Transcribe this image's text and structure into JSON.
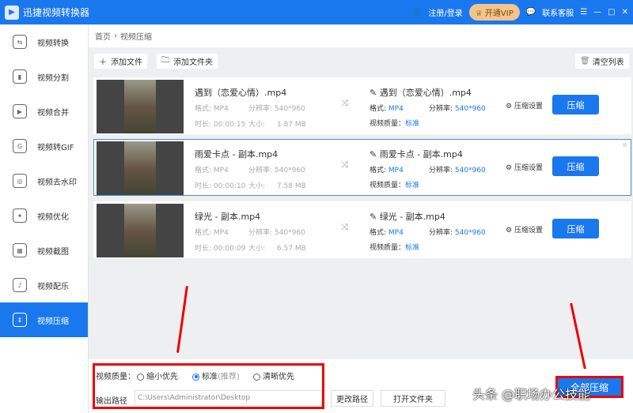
{
  "app": {
    "title": "迅捷视频转换器",
    "login": "注册/登录",
    "vip": "开通VIP",
    "support": "联系客服"
  },
  "sidebar": {
    "items": [
      {
        "label": "视频转换",
        "icon": "⇆"
      },
      {
        "label": "视频分割",
        "icon": "▮"
      },
      {
        "label": "视频合并",
        "icon": "▶"
      },
      {
        "label": "视频转GIF",
        "icon": "G"
      },
      {
        "label": "视频去水印",
        "icon": "◎"
      },
      {
        "label": "视频优化",
        "icon": "✦"
      },
      {
        "label": "视频截图",
        "icon": "▦"
      },
      {
        "label": "视频配乐",
        "icon": "♪"
      },
      {
        "label": "视频压缩",
        "icon": "⇕"
      }
    ]
  },
  "breadcrumb": {
    "home": "首页",
    "sep": "›",
    "current": "视频压缩"
  },
  "toolbar": {
    "add_file": "添加文件",
    "add_folder": "添加文件夹",
    "clear": "清空列表"
  },
  "labels": {
    "format": "格式:",
    "resolution": "分辨率:",
    "duration": "时长:",
    "size": "大小:",
    "quality": "视频质量：",
    "settings": "压缩设置",
    "compress": "压缩"
  },
  "files": [
    {
      "name": "遇到（恋爱心情）.mp4",
      "format": "MP4",
      "resolution": "540*960",
      "duration": "00:00:15",
      "size": "1.87 MB",
      "out_name": "遇到（恋爱心情）.mp4",
      "out_format": "MP4",
      "out_resolution": "540*960",
      "out_quality": "标准"
    },
    {
      "name": "雨爱卡点 - 副本.mp4",
      "format": "MP4",
      "resolution": "540*960",
      "duration": "00:00:10",
      "size": "7.58 MB",
      "out_name": "雨爱卡点 - 副本.mp4",
      "out_format": "MP4",
      "out_resolution": "540*960",
      "out_quality": "标准"
    },
    {
      "name": "绿光 - 副本.mp4",
      "format": "MP4",
      "resolution": "540*960",
      "duration": "00:00:09",
      "size": "6.57 MB",
      "out_name": "绿光 - 副本.mp4",
      "out_format": "MP4",
      "out_resolution": "540*960",
      "out_quality": "标准"
    }
  ],
  "bottom": {
    "quality_label": "视频质量：",
    "opt1": "缩小优先",
    "opt2": "标准",
    "opt2_note": "(推荐)",
    "opt3": "清晰优先",
    "selected": "标准",
    "path_label": "输出路径",
    "path": "C:\\Users\\Administrator\\Desktop",
    "change_path": "更改路径",
    "open_folder": "打开文件夹",
    "compress_all": "全部压缩"
  },
  "watermark": "头条 @职场办公技能"
}
